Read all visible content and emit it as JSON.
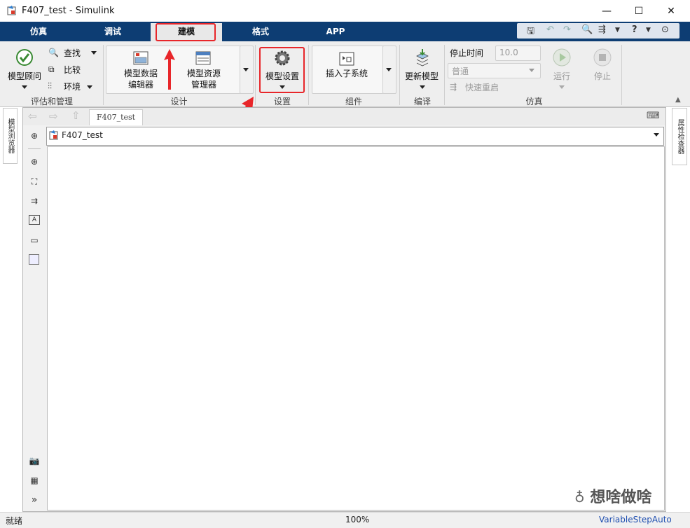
{
  "window": {
    "title": "F407_test - Simulink"
  },
  "window_controls": {
    "minimize": "—",
    "maximize": "☐",
    "close": "✕"
  },
  "tabs": [
    {
      "label": "仿真"
    },
    {
      "label": "调试"
    },
    {
      "label": "建模"
    },
    {
      "label": "格式"
    },
    {
      "label": "APP"
    }
  ],
  "ribbon": {
    "assess": {
      "group_label": "评估和管理",
      "model_advisor": "模型顾问",
      "find": "查找",
      "compare": "比较",
      "environment": "环境"
    },
    "design": {
      "group_label": "设计",
      "model_data_editor_1": "模型数据",
      "model_data_editor_2": "编辑器",
      "model_explorer_1": "模型资源",
      "model_explorer_2": "管理器"
    },
    "setup": {
      "group_label": "设置",
      "model_settings": "模型设置"
    },
    "component": {
      "group_label": "组件",
      "insert_subsystem": "插入子系统"
    },
    "compile": {
      "group_label": "编译",
      "update_model": "更新模型"
    },
    "simulation": {
      "group_label": "仿真",
      "stop_time_label": "停止时间",
      "stop_time_value": "10.0",
      "mode_value": "普通",
      "fast_restart": "快速重启",
      "run": "运行",
      "stop": "停止"
    }
  },
  "left_panel": {
    "model_browser": "模型浏览器"
  },
  "right_panel": {
    "property_inspector": "属性检查器"
  },
  "editor": {
    "breadcrumb_tab": "F407_test",
    "address": "F407_test"
  },
  "status": {
    "left": "就绪",
    "zoom": "100%",
    "solver": "VariableStepAuto"
  },
  "watermark": {
    "text": "想啥做啥"
  },
  "colors": {
    "tabbar": "#0d3d73",
    "highlight": "#e8262a",
    "solver_link": "#1f4fb0"
  }
}
